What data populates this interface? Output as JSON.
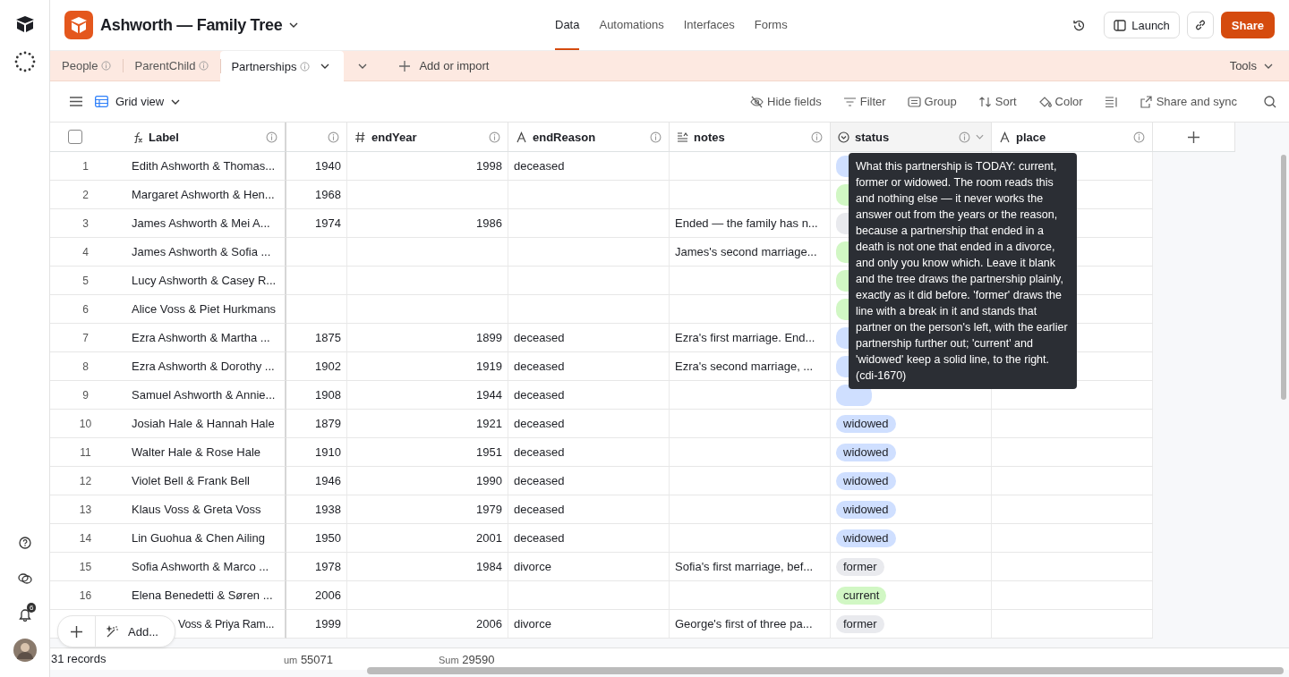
{
  "app": {
    "title": "Ashworth — Family Tree",
    "notifications": "6"
  },
  "nav": [
    {
      "label": "Data",
      "selected": true
    },
    {
      "label": "Automations",
      "selected": false
    },
    {
      "label": "Interfaces",
      "selected": false
    },
    {
      "label": "Forms",
      "selected": false
    }
  ],
  "actions": {
    "launch": "Launch",
    "share": "Share"
  },
  "tables": [
    {
      "label": "People",
      "selected": false
    },
    {
      "label": "ParentChild",
      "selected": false
    },
    {
      "label": "Partnerships",
      "selected": true
    }
  ],
  "add_table": "Add or import",
  "tools": "Tools",
  "view": {
    "label": "Grid view"
  },
  "toolbar": [
    {
      "kind": "hide",
      "label": "Hide fields"
    },
    {
      "kind": "filter",
      "label": "Filter"
    },
    {
      "kind": "group",
      "label": "Group"
    },
    {
      "kind": "sort",
      "label": "Sort"
    },
    {
      "kind": "color",
      "label": "Color"
    },
    {
      "kind": "rowheight"
    },
    {
      "kind": "share",
      "label": "Share and sync"
    }
  ],
  "select_all": {
    "checked": false
  },
  "columns": [
    {
      "kind": "formula",
      "name": "Label"
    },
    {},
    {
      "kind": "number",
      "name": "endYear"
    },
    {
      "kind": "text",
      "name": "endReason"
    },
    {
      "kind": "longtext",
      "name": "notes"
    },
    {
      "kind": "select",
      "name": "status",
      "hovered": true
    },
    {
      "kind": "text",
      "name": "place"
    }
  ],
  "rows": [
    {
      "number": "1",
      "label": "Edith Ashworth & Thomas...",
      "column_2": "1940",
      "endYear": "1998",
      "endReason": "deceased",
      "status": {
        "kind": "widowed"
      }
    },
    {
      "number": "2",
      "label": "Margaret Ashworth & Hen...",
      "column_2": "1968",
      "status": {
        "kind": "current"
      }
    },
    {
      "number": "3",
      "label": "James Ashworth & Mei A...",
      "column_2": "1974",
      "endYear": "1986",
      "notes": "Ended — the family has n...",
      "status": {
        "kind": "former"
      }
    },
    {
      "number": "4",
      "label": "James Ashworth & Sofia ...",
      "notes": "James's second marriage...",
      "status": {
        "kind": "current"
      }
    },
    {
      "number": "5",
      "label": "Lucy Ashworth & Casey R...",
      "status": {
        "kind": "current"
      }
    },
    {
      "number": "6",
      "label": "Alice Voss & Piet Hurkmans",
      "status": {
        "kind": "current"
      }
    },
    {
      "number": "7",
      "label": "Ezra Ashworth & Martha ...",
      "column_2": "1875",
      "endYear": "1899",
      "endReason": "deceased",
      "notes": "Ezra's first marriage. End...",
      "status": {
        "kind": "widowed"
      }
    },
    {
      "number": "8",
      "label": "Ezra Ashworth & Dorothy ...",
      "column_2": "1902",
      "endYear": "1919",
      "endReason": "deceased",
      "notes": "Ezra's second marriage, ...",
      "status": {
        "kind": "widowed"
      }
    },
    {
      "number": "9",
      "label": "Samuel Ashworth & Annie...",
      "column_2": "1908",
      "endYear": "1944",
      "endReason": "deceased",
      "status": {
        "kind": "widowed"
      }
    },
    {
      "number": "10",
      "label": "Josiah Hale & Hannah Hale",
      "column_2": "1879",
      "endYear": "1921",
      "endReason": "deceased",
      "status": {
        "kind": "widowed",
        "label": "widowed"
      }
    },
    {
      "number": "11",
      "label": "Walter Hale & Rose Hale",
      "column_2": "1910",
      "endYear": "1951",
      "endReason": "deceased",
      "status": {
        "kind": "widowed",
        "label": "widowed"
      }
    },
    {
      "number": "12",
      "label": "Violet Bell & Frank Bell",
      "column_2": "1946",
      "endYear": "1990",
      "endReason": "deceased",
      "status": {
        "kind": "widowed",
        "label": "widowed"
      }
    },
    {
      "number": "13",
      "label": "Klaus Voss & Greta Voss",
      "column_2": "1938",
      "endYear": "1979",
      "endReason": "deceased",
      "status": {
        "kind": "widowed",
        "label": "widowed"
      }
    },
    {
      "number": "14",
      "label": "Lin Guohua & Chen Ailing",
      "column_2": "1950",
      "endYear": "2001",
      "endReason": "deceased",
      "status": {
        "kind": "widowed",
        "label": "widowed"
      }
    },
    {
      "number": "15",
      "label": "Sofia Ashworth & Marco ...",
      "column_2": "1978",
      "endYear": "1984",
      "endReason": "divorce",
      "notes": "Sofia's first marriage, bef...",
      "status": {
        "kind": "former",
        "label": "former"
      }
    },
    {
      "number": "16",
      "label": "Elena Benedetti & Søren ...",
      "column_2": "2006",
      "status": {
        "kind": "current",
        "label": "current"
      }
    },
    {
      "covered": true,
      "label": "Voss & Priya Ram...",
      "column_2": "1999",
      "endYear": "2006",
      "endReason": "divorce",
      "notes": "George's first of three pa...",
      "status": {
        "kind": "former",
        "label": "former"
      }
    }
  ],
  "tooltip": "What this partnership is TODAY: current, former or widowed. The room reads this and nothing else — it never works the answer out from the years or the reason, because a partnership that ended in a death is not one that ended in a divorce, and only you know which. Leave it blank and the tree draws the partnership plainly, exactly as it did before. 'former' draws the line with a break in it and stands that partner on the person's left, with the earlier partnership further out; 'current' and 'widowed' keep a solid line, to the right. (cdi-1670)",
  "footer": {
    "records": "31 records",
    "sums": [
      {
        "label": "um",
        "value": "55071"
      },
      {
        "label": "Sum",
        "value": "29590"
      }
    ]
  },
  "add_button": "Add..."
}
